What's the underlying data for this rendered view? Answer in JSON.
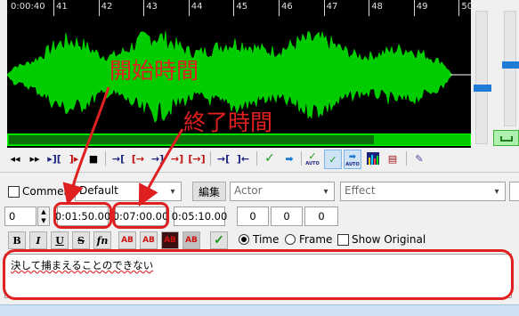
{
  "timeline": {
    "start_time": "0:00:40",
    "tick_labels": [
      "41",
      "42",
      "43",
      "44",
      "45",
      "46",
      "47",
      "48",
      "49",
      "50"
    ]
  },
  "annotations": {
    "start_label": "開始時間",
    "end_label": "終了時間",
    "color": "#e02020"
  },
  "toolbar": {
    "buttons": [
      "rewind-icon",
      "play-icon",
      "play-selection-icon",
      "play-before-icon",
      "stop-icon",
      "play-start-icon",
      "play-end-icon",
      "play-after-icon",
      "play-next-icon",
      "play-loop-icon",
      "set-start-icon",
      "set-end-icon",
      "commit-icon",
      "next-line-icon",
      "auto-commit-icon",
      "auto-scroll-icon",
      "auto-next-icon",
      "spectrum-icon",
      "karaoke-icon",
      "settings-icon"
    ],
    "auto_label": "AUTO",
    "active_color": "#cfe3f7"
  },
  "edit": {
    "comment_label": "Comment",
    "style_value": "Default",
    "edit_button": "編集",
    "actor_placeholder": "Actor",
    "effect_placeholder": "Effect",
    "layer_value": "0",
    "start_time": "0:01:50.00",
    "end_time": "0:07:00.00",
    "duration": "0:05:10.00",
    "margin_left": "0",
    "margin_right": "0",
    "margin_vertical": "0",
    "format_buttons": [
      "B",
      "I",
      "U",
      "S",
      "fn",
      "AB",
      "AB",
      "AB",
      "AB"
    ],
    "time_label": "Time",
    "frame_label": "Frame",
    "show_original_label": "Show Original",
    "text": "決して捕まえることのできない"
  },
  "colors": {
    "waveform": "#00cc00",
    "waveform_background": "#000000",
    "slider_accent": "#1e7bd6"
  }
}
